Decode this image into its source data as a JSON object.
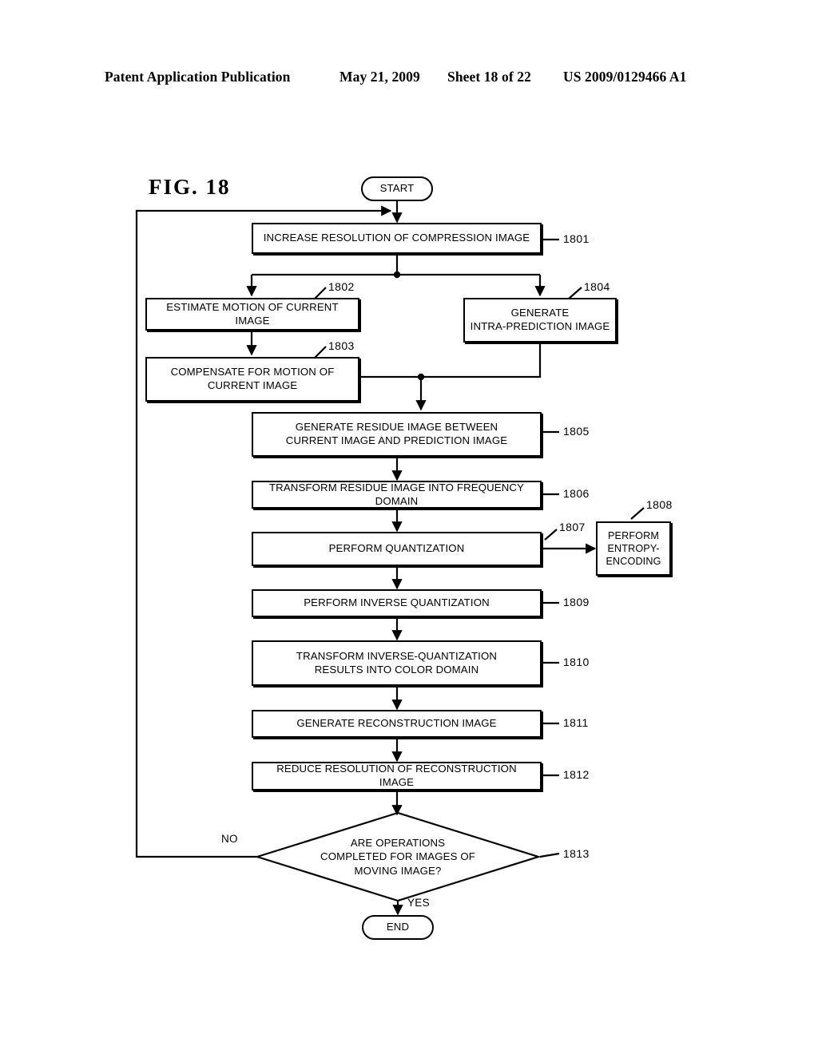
{
  "header": {
    "publication": "Patent Application Publication",
    "date": "May 21, 2009",
    "sheet": "Sheet 18 of 22",
    "number": "US 2009/0129466 A1"
  },
  "figure": {
    "label": "FIG.  18"
  },
  "flowchart": {
    "start": "START",
    "end": "END",
    "steps": [
      {
        "ref": "1801",
        "text": "INCREASE RESOLUTION OF COMPRESSION IMAGE"
      },
      {
        "ref": "1802",
        "text": "ESTIMATE MOTION OF CURRENT IMAGE"
      },
      {
        "ref": "1803",
        "text": "COMPENSATE FOR MOTION OF\nCURRENT IMAGE"
      },
      {
        "ref": "1804",
        "text": "GENERATE\nINTRA-PREDICTION IMAGE"
      },
      {
        "ref": "1805",
        "text": "GENERATE RESIDUE IMAGE BETWEEN\nCURRENT IMAGE AND PREDICTION IMAGE"
      },
      {
        "ref": "1806",
        "text": "TRANSFORM RESIDUE IMAGE INTO FREQUENCY DOMAIN"
      },
      {
        "ref": "1807",
        "text": "PERFORM QUANTIZATION"
      },
      {
        "ref": "1808",
        "text": "PERFORM\nENTROPY-\nENCODING"
      },
      {
        "ref": "1809",
        "text": "PERFORM INVERSE QUANTIZATION"
      },
      {
        "ref": "1810",
        "text": "TRANSFORM INVERSE-QUANTIZATION\nRESULTS INTO COLOR DOMAIN"
      },
      {
        "ref": "1811",
        "text": "GENERATE RECONSTRUCTION IMAGE"
      },
      {
        "ref": "1812",
        "text": "REDUCE RESOLUTION OF RECONSTRUCTION IMAGE"
      },
      {
        "ref": "1813",
        "text": "ARE OPERATIONS\nCOMPLETED FOR IMAGES OF\nMOVING IMAGE?"
      }
    ],
    "branches": {
      "no": "NO",
      "yes": "YES"
    }
  },
  "colors": {
    "ink": "#000000",
    "paper": "#ffffff"
  }
}
